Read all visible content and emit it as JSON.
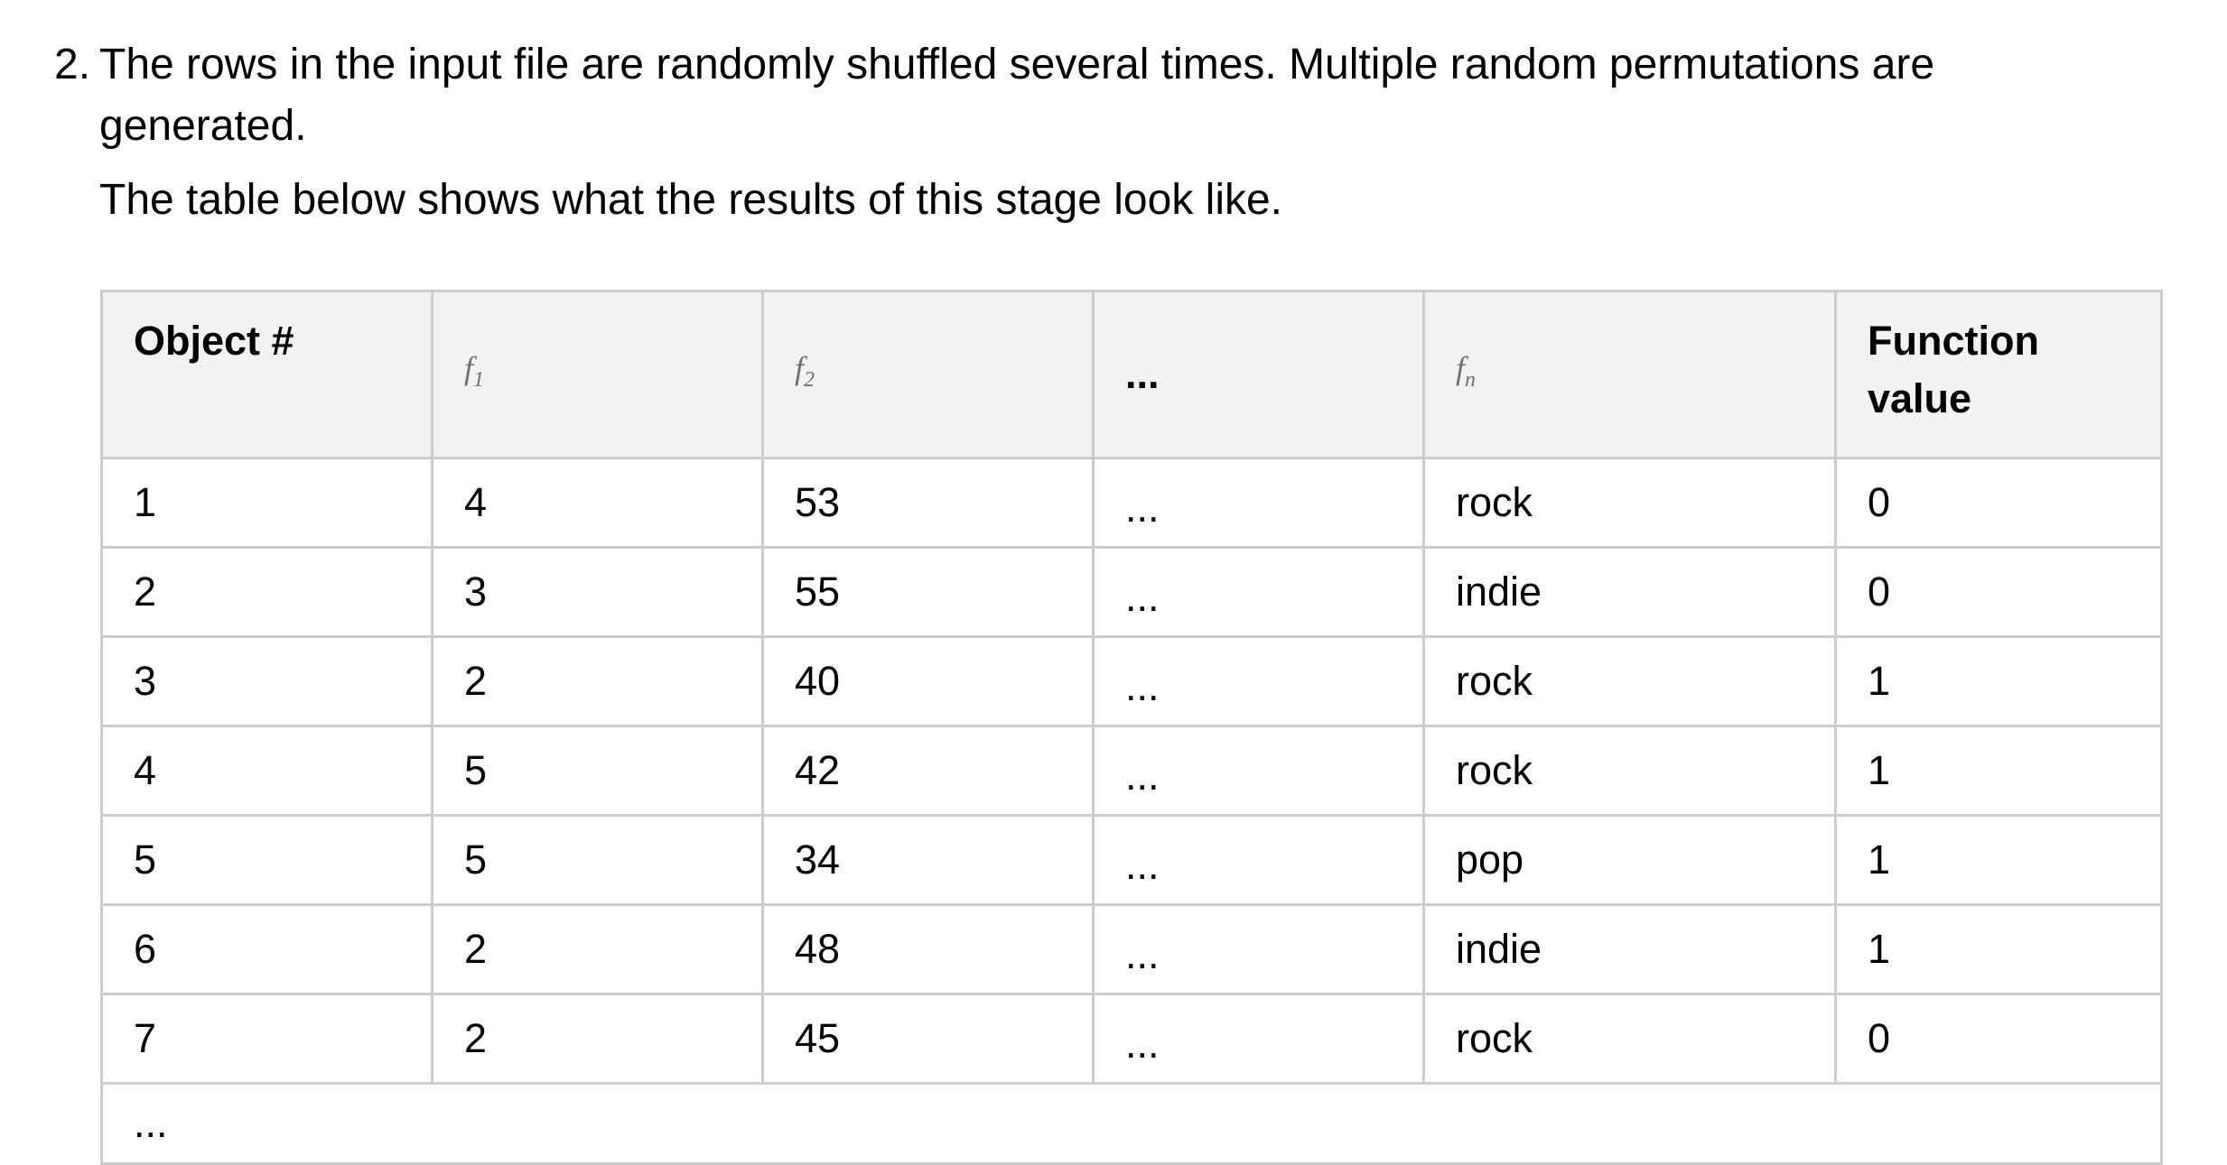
{
  "list_item": {
    "number": "2.",
    "text_line1": "The rows in the input file are randomly shuffled several times. Multiple random permutations are",
    "text_line2": "generated."
  },
  "intro": "The table below shows what the results of this stage look like.",
  "table": {
    "headers": {
      "object": "Object #",
      "f1_base": "f",
      "f1_sub": "1",
      "f2_base": "f",
      "f2_sub": "2",
      "dots": "...",
      "fn_base": "f",
      "fn_sub": "n",
      "function_line1": "Function",
      "function_line2": "value"
    },
    "rows": [
      {
        "object": "1",
        "f1": "4",
        "f2": "53",
        "dots": "...",
        "fn": "rock",
        "value": "0"
      },
      {
        "object": "2",
        "f1": "3",
        "f2": "55",
        "dots": "...",
        "fn": "indie",
        "value": "0"
      },
      {
        "object": "3",
        "f1": "2",
        "f2": "40",
        "dots": "...",
        "fn": "rock",
        "value": "1"
      },
      {
        "object": "4",
        "f1": "5",
        "f2": "42",
        "dots": "...",
        "fn": "rock",
        "value": "1"
      },
      {
        "object": "5",
        "f1": "5",
        "f2": "34",
        "dots": "...",
        "fn": "pop",
        "value": "1"
      },
      {
        "object": "6",
        "f1": "2",
        "f2": "48",
        "dots": "...",
        "fn": "indie",
        "value": "1"
      },
      {
        "object": "7",
        "f1": "2",
        "f2": "45",
        "dots": "...",
        "fn": "rock",
        "value": "0"
      }
    ],
    "more_row": "..."
  }
}
